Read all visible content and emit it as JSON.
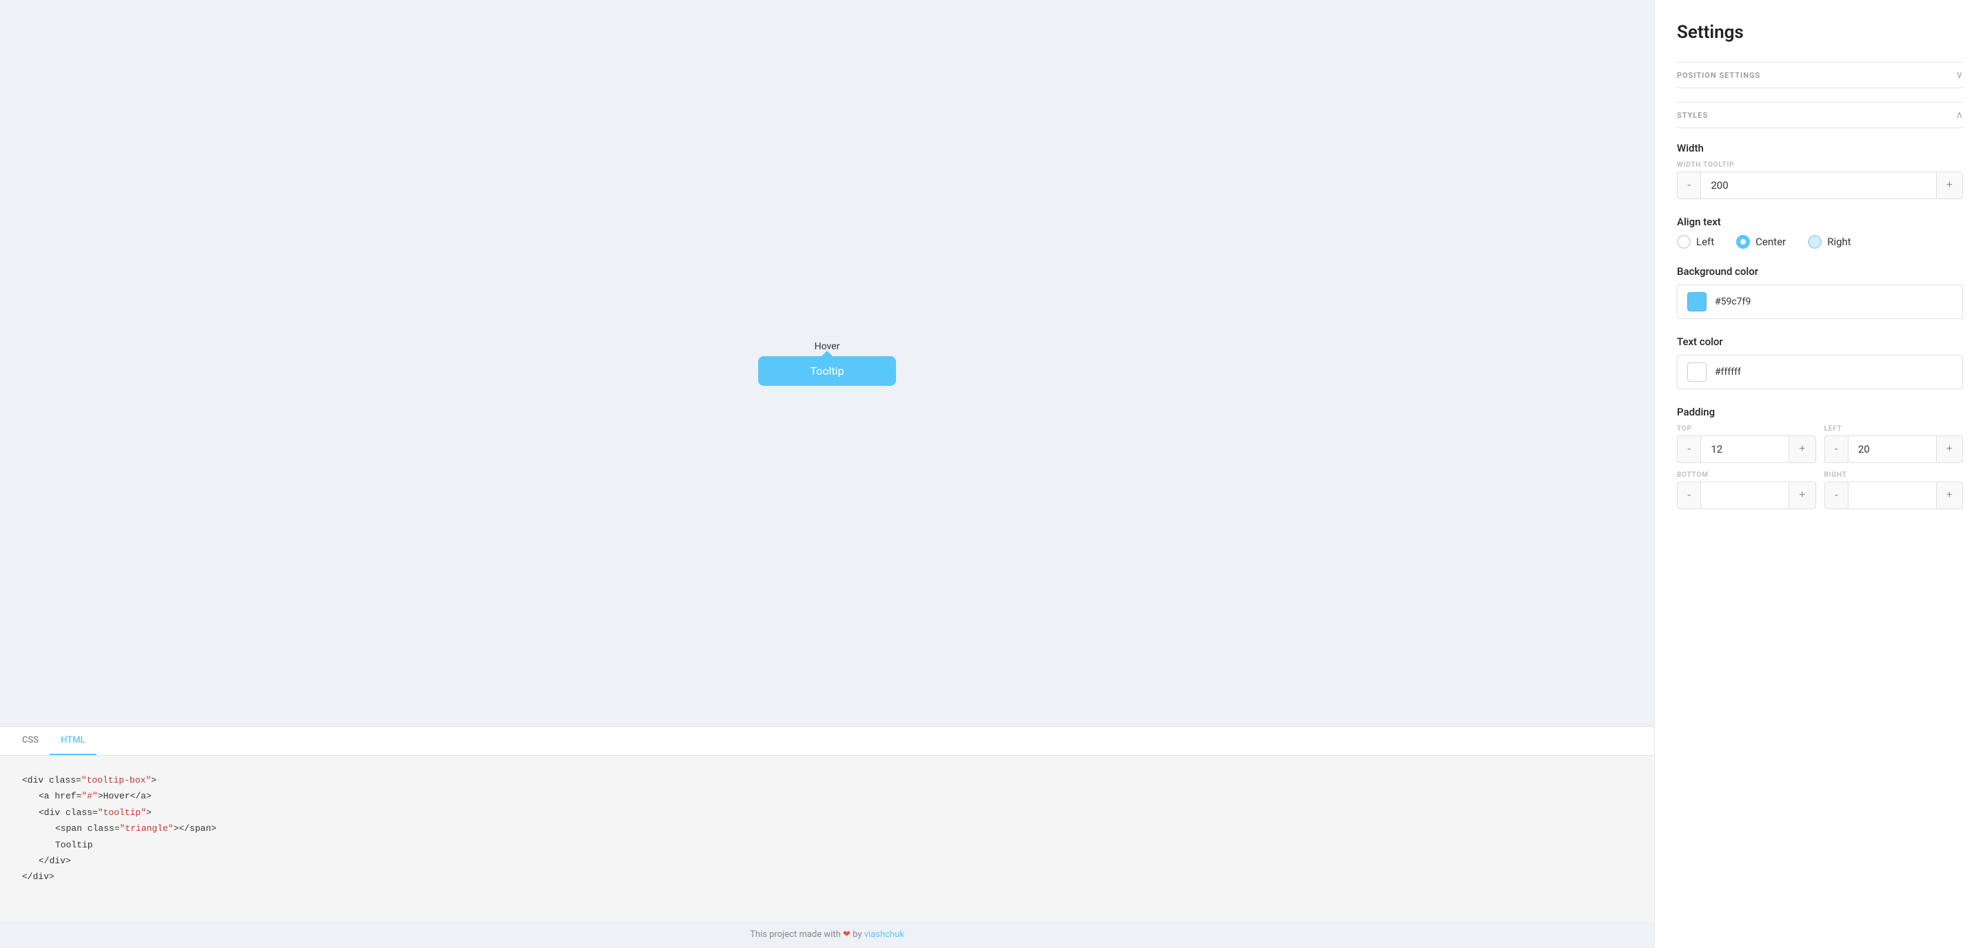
{
  "preview": {
    "hover_label": "Hover",
    "tooltip_text": "Tooltip"
  },
  "code": {
    "tabs": [
      {
        "id": "css",
        "label": "CSS"
      },
      {
        "id": "html",
        "label": "HTML"
      }
    ],
    "active_tab": "HTML",
    "lines": [
      {
        "indent": 0,
        "content": "<div class=\"tooltip-box\">",
        "type": "tag"
      },
      {
        "indent": 1,
        "content": "  <a href=\"#\">Hover</a>",
        "type": "mixed"
      },
      {
        "indent": 1,
        "content": "  <div class=\"tooltip\">",
        "type": "tag"
      },
      {
        "indent": 2,
        "content": "    <span class=\"triangle\"></span>",
        "type": "mixed"
      },
      {
        "indent": 2,
        "content": "    Tooltip",
        "type": "text"
      },
      {
        "indent": 1,
        "content": "  </div>",
        "type": "tag"
      },
      {
        "indent": 0,
        "content": "</div>",
        "type": "tag"
      }
    ]
  },
  "footer": {
    "text_before": "This project made with",
    "heart": "❤",
    "text_middle": "by",
    "link_text": "viashchuk",
    "link_href": "#"
  },
  "settings": {
    "title": "Settings",
    "sections": {
      "position": {
        "label": "POSITION SETTINGS",
        "chevron": "∨"
      },
      "styles": {
        "label": "STYLES",
        "chevron": "∧"
      }
    },
    "width": {
      "label": "Width",
      "sub_label": "WIDTH TOOLTIP",
      "value": "200",
      "btn_minus": "-",
      "btn_plus": "+"
    },
    "align_text": {
      "label": "Align text",
      "options": [
        {
          "id": "left",
          "label": "Left",
          "state": "unchecked"
        },
        {
          "id": "center",
          "label": "Center",
          "state": "checked"
        },
        {
          "id": "right",
          "label": "Right",
          "state": "partial"
        }
      ]
    },
    "background_color": {
      "label": "Background color",
      "value": "#59c7f9",
      "swatch": "#59c7f9"
    },
    "text_color": {
      "label": "Text color",
      "value": "#ffffff",
      "swatch": "#ffffff"
    },
    "padding": {
      "label": "Padding",
      "top": {
        "sub_label": "TOP",
        "value": "12",
        "btn_minus": "-",
        "btn_plus": "+"
      },
      "left": {
        "sub_label": "LEFT",
        "value": "20",
        "btn_minus": "-",
        "btn_plus": "+"
      },
      "bottom": {
        "sub_label": "BOTTOM",
        "value": "",
        "btn_minus": "-",
        "btn_plus": "+"
      },
      "right": {
        "sub_label": "RIGHT",
        "value": "",
        "btn_minus": "-",
        "btn_plus": "+"
      }
    }
  }
}
